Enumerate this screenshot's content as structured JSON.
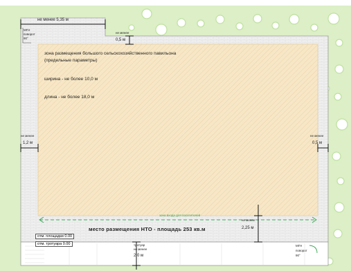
{
  "dimensions": {
    "top_left_width": "не менее 5,35 м",
    "top_gap_min": "не менее",
    "top_gap_val": "0,5 м",
    "left_gap_min": "не менее",
    "left_gap_val": "1,2 м",
    "right_gap_min": "не менее",
    "right_gap_val": "0,5 м",
    "bottom_gap_min": "не менее",
    "bottom_gap_val": "2,25 м",
    "sidewalk_title": "тротуар",
    "sidewalk_min": "не менее",
    "sidewalk_val": "2,0 м"
  },
  "pavilion_zone": {
    "title_line1": "зона размещения большого сельскохозяйственного павильона",
    "title_line2": "(предельные параметры)",
    "width_limit": "ширина - не более 10,0 м",
    "length_limit": "длина - не более 18,0 м"
  },
  "entry_zone_label": "зона входа для посетителей",
  "nto_label": "место размещения НТО - площадь 253 кв.м",
  "elevation_square": "отм. площадки 0.00",
  "elevation_sidewalk": "отм. тротуара 0.00",
  "mgn_top": {
    "line1": "МГН",
    "line2": "поворот",
    "line3": "90°"
  },
  "mgn_bottom": {
    "line1": "МГН",
    "line2": "поворот",
    "line3": "90°"
  },
  "colors": {
    "lawn": "#dcefc6",
    "tree": "#c8e6ad",
    "pavilion": "#f7e7c7",
    "paving": "#eeeeee",
    "dim_line": "#111111",
    "entry_line": "#39a552"
  }
}
